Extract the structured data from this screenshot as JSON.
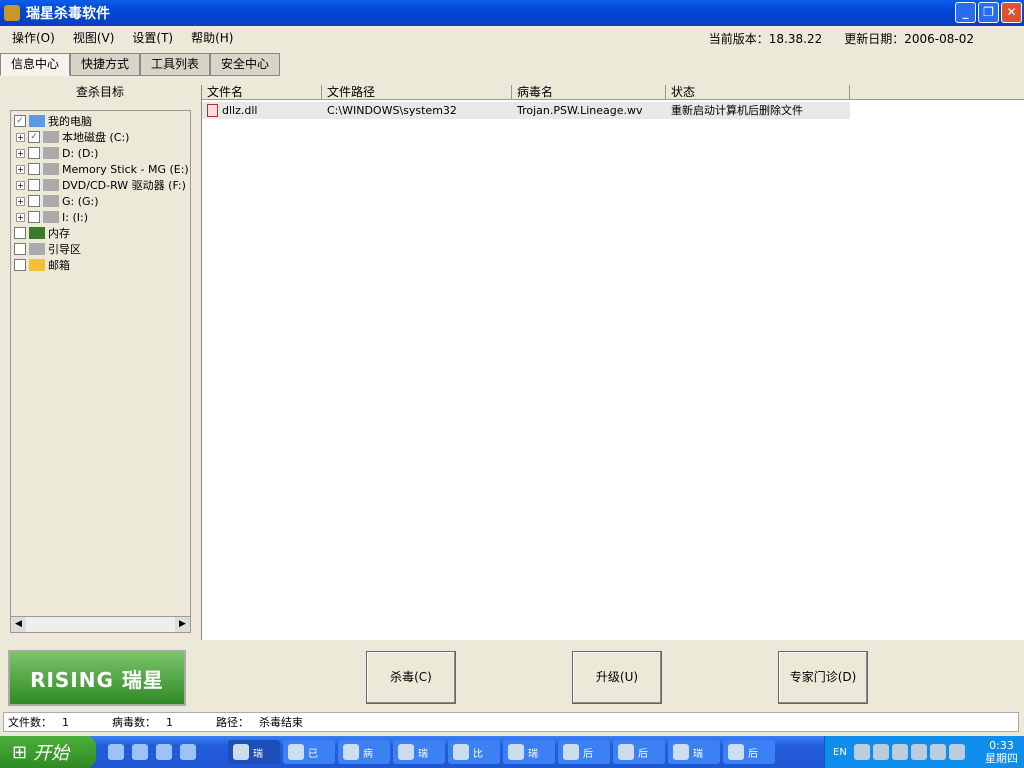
{
  "window": {
    "title": "瑞星杀毒软件",
    "min": "_",
    "max": "❐",
    "close": "✕"
  },
  "menu": [
    "操作(O)",
    "视图(V)",
    "设置(T)",
    "帮助(H)"
  ],
  "version": {
    "label": "当前版本：18.38.22",
    "update": "更新日期：2006-08-02"
  },
  "tabs": [
    "信息中心",
    "快捷方式",
    "工具列表",
    "安全中心"
  ],
  "left": {
    "header": "查杀目标",
    "tree": [
      {
        "label": "我的电脑",
        "level": 0,
        "checked": true
      },
      {
        "label": "本地磁盘 (C:)",
        "level": 1,
        "checked": true
      },
      {
        "label": "D: (D:)",
        "level": 1,
        "checked": false
      },
      {
        "label": "Memory Stick - MG (E:)",
        "level": 1,
        "checked": false
      },
      {
        "label": "DVD/CD-RW 驱动器 (F:)",
        "level": 1,
        "checked": false
      },
      {
        "label": "G: (G:)",
        "level": 1,
        "checked": false
      },
      {
        "label": "I: (I:)",
        "level": 1,
        "checked": false
      },
      {
        "label": "内存",
        "level": 0,
        "checked": false
      },
      {
        "label": "引导区",
        "level": 0,
        "checked": false
      },
      {
        "label": "邮箱",
        "level": 0,
        "checked": false
      }
    ]
  },
  "table": {
    "columns": [
      "文件名",
      "文件路径",
      "病毒名",
      "状态"
    ],
    "rows": [
      [
        "dllz.dll",
        "C:\\WINDOWS\\system32",
        "Trojan.PSW.Lineage.wv",
        "重新启动计算机后删除文件"
      ]
    ]
  },
  "brand": "RISING 瑞星",
  "actions": [
    "杀毒(C)",
    "升级(U)",
    "专家门诊(D)"
  ],
  "status": {
    "files_label": "文件数：",
    "files": "1",
    "virus_label": "病毒数：",
    "virus": "1",
    "path_label": "路径：",
    "path": "杀毒结束"
  },
  "taskbar": {
    "start": "开始",
    "buttons": [
      "瑞",
      "已",
      "病",
      "瑞",
      "比",
      "瑞",
      "后",
      "后",
      "瑞",
      "后"
    ],
    "lang": "EN",
    "time": "0:33",
    "day": "星期四"
  }
}
